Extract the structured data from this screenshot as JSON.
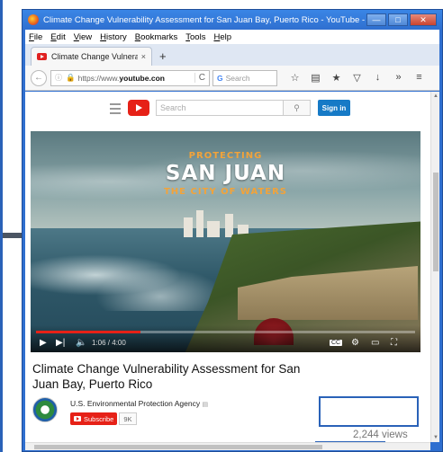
{
  "window": {
    "title": "Climate Change Vulnerability Assessment for San Juan Bay, Puerto Rico - YouTube - Mozilla Firefox",
    "minimize": "—",
    "maximize": "□",
    "close": "✕"
  },
  "menu": [
    "File",
    "Edit",
    "View",
    "History",
    "Bookmarks",
    "Tools",
    "Help"
  ],
  "tab": {
    "title": "Climate Change Vulnerabil...",
    "close": "×",
    "new": "+"
  },
  "nav": {
    "url_prefix": "https://www.",
    "url_domain": "youtube.con",
    "search_placeholder": "Search",
    "search_engine_glyph": "G",
    "reload": "C"
  },
  "youtube": {
    "search_placeholder": "Search",
    "signin": "Sign in"
  },
  "video": {
    "overlay_line1": "PROTECTING",
    "overlay_line2": "SAN JUAN",
    "overlay_line3": "THE CITY OF WATERS",
    "time": "1:06 / 4:00",
    "progress": 0.275,
    "cc": "CC"
  },
  "info": {
    "title": "Climate Change Vulnerability Assessment for San Juan Bay, Puerto Rico",
    "channel": "U.S. Environmental Protection Agency",
    "subscribe": "Subscribe",
    "subscribers": "9K",
    "views": "2,244 views"
  },
  "colors": {
    "accent": "#2a62b8",
    "youtube_red": "#e62117",
    "signin_blue": "#167ac6"
  }
}
